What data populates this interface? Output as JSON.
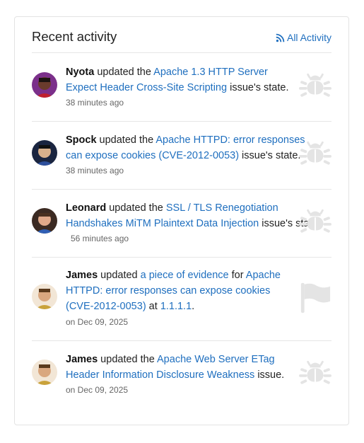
{
  "header": {
    "title": "Recent activity",
    "all_activity_label": "All Activity"
  },
  "activities": [
    {
      "user": "Nyota",
      "verb": " updated the ",
      "link1": "Apache 1.3 HTTP Server",
      "link1b": "Expect Header Cross-Site Scripting",
      "suffix": " issue's state.",
      "time": "38 minutes ago",
      "icon": "bug-icon"
    },
    {
      "user": "Spock",
      "verb": " updated the ",
      "link1": "Apache HTTPD: error responses",
      "link1b": "can expose cookies (CVE-2012-0053)",
      "suffix": " issue's state.",
      "time": "38 minutes ago",
      "icon": "bug-icon"
    },
    {
      "user": "Leonard",
      "verb": " updated the ",
      "link1": "SSL / TLS Renegotiation",
      "link1b": "Handshakes MiTM Plaintext Data Injection",
      "suffix": " issue's state.",
      "time": "56 minutes ago",
      "icon": "bug-icon"
    },
    {
      "user": "James",
      "verb": " updated ",
      "link1": "a piece of evidence",
      "mid": " for ",
      "link2": "Apache",
      "link2b": "HTTPD: error responses can expose cookies",
      "link2c": "(CVE-2012-0053)",
      "at": " at ",
      "link3": "1.1.1.1",
      "suffix": ".",
      "time": "on Dec 09, 2025",
      "icon": "flag-icon"
    },
    {
      "user": "James",
      "verb": " updated the ",
      "link1": "Apache Web Server ETag",
      "link1b": "Header Information Disclosure Weakness",
      "suffix": " issue.",
      "time": "on Dec 09, 2025",
      "icon": "bug-icon"
    }
  ],
  "colors": {
    "link": "#1f6fbf",
    "muted_icon": "#e4e4e4"
  }
}
